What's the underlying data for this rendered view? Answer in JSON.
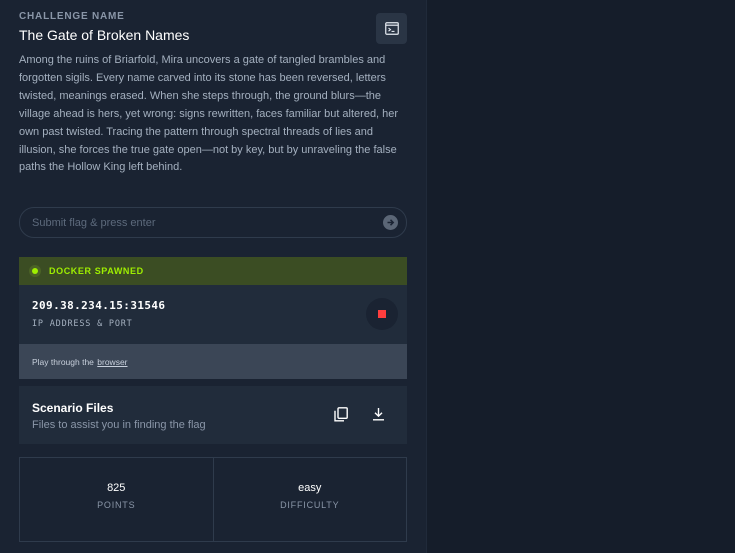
{
  "challenge": {
    "eyebrow": "CHALLENGE NAME",
    "title": "The Gate of Broken Names",
    "description": "Among the ruins of Briarfold, Mira uncovers a gate of tangled brambles and forgotten sigils. Every name carved into its stone has been reversed, letters twisted, meanings erased. When she steps through, the ground blurs—the village ahead is hers, yet wrong: signs rewritten, faces familiar but altered, her own past twisted. Tracing the pattern through spectral threads of lies and illusion, she forces the true gate open—not by key, but by unraveling the false paths the Hollow King left behind."
  },
  "toolbar": {
    "terminal_icon": "terminal-icon"
  },
  "flag_input": {
    "placeholder": "Submit flag & press enter",
    "value": "",
    "submit_icon": "arrow-right-icon"
  },
  "docker": {
    "status": "DOCKER SPAWNED",
    "status_color": "#9fef00",
    "ip_port": "209.38.234.15:31546",
    "ip_label": "IP ADDRESS & PORT",
    "stop_icon": "stop-icon",
    "play_prefix": "Play through the ",
    "play_link": "browser"
  },
  "files": {
    "title": "Scenario Files",
    "subtitle": "Files to assist you in finding the flag",
    "copy_icon": "copy-icon",
    "download_icon": "download-icon"
  },
  "stats": {
    "points_value": "825",
    "points_label": "POINTS",
    "difficulty_value": "easy",
    "difficulty_label": "DIFFICULTY"
  },
  "colors": {
    "accent": "#9fef00",
    "danger": "#ff3e3e",
    "panel": "#1a2332"
  }
}
